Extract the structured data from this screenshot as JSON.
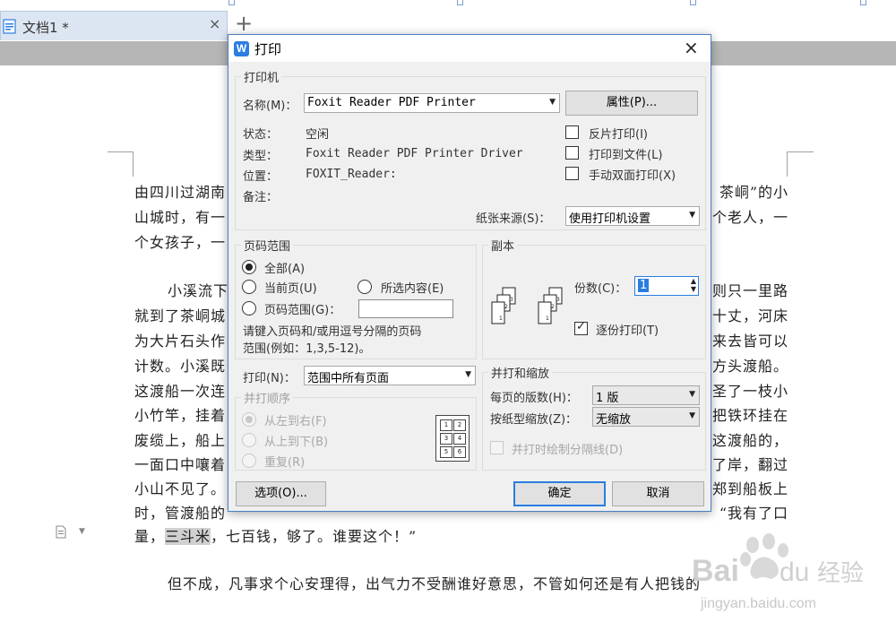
{
  "tab": {
    "title": "文档1 *",
    "close": "×",
    "new_tab": "+"
  },
  "document": {
    "lines": [
      {
        "left": "由四川过湖南",
        "right": "茶峒”的小"
      },
      {
        "left": "山城时，有一",
        "right": "个老人，一"
      },
      {
        "left": "个女孩子，一",
        "right": ""
      },
      {
        "left": "小溪流下",
        "right": "则只一里路"
      },
      {
        "left": "就到了茶峒城",
        "right": "十丈，河床"
      },
      {
        "left": "为大片石头作",
        "right": "来去皆可以"
      },
      {
        "left": "计数。小溪既",
        "right": "方头渡船。"
      },
      {
        "left": "这渡船一次连",
        "right": "圣了一枝小"
      },
      {
        "left": "小竹竿，挂着",
        "right": "把铁环挂在"
      },
      {
        "left": "废缆上，船上",
        "right": "这渡船的，"
      },
      {
        "left": "一面口中嚷着",
        "right": "了岸，翻过"
      },
      {
        "left": "小山不见了。",
        "right": "郑到船板上"
      },
      {
        "left": "时，管渡船的",
        "right": "“我有了口"
      }
    ],
    "line14_highlight": "三斗米",
    "line14_prefix": "量，",
    "line14_suffix": "，七百钱，够了。谁要这个！”",
    "line15": "但不成，凡事求个心安理得，出气力不受酬谁好意思，不管如何还是有人把钱的"
  },
  "dialog": {
    "title": "打印",
    "close": "×",
    "printer": {
      "group_label": "打印机",
      "name_label": "名称(M)：",
      "name_value": "Foxit Reader PDF Printer",
      "properties_button": "属性(P)...",
      "status_label": "状态：",
      "status_value": "空闲",
      "type_label": "类型：",
      "type_value": "Foxit Reader PDF Printer Driver",
      "location_label": "位置：",
      "location_value": "FOXIT_Reader:",
      "comment_label": "备注：",
      "reverse_print": "反片打印(I)",
      "print_to_file": "打印到文件(L)",
      "manual_duplex": "手动双面打印(X)",
      "paper_source_label": "纸张来源(S)：",
      "paper_source_value": "使用打印机设置"
    },
    "page_range": {
      "group_label": "页码范围",
      "all": "全部(A)",
      "current": "当前页(U)",
      "selection": "所选内容(E)",
      "pages": "页码范围(G)：",
      "pages_value": "",
      "hint": "请键入页码和/或用逗号分隔的页码范围(例如：1,3,5-12)。",
      "hint_line1": "请键入页码和/或用逗号分隔的页码",
      "hint_line2": "范围(例如：1,3,5-12)。"
    },
    "copies": {
      "group_label": "副本",
      "count_label": "份数(C)：",
      "count_value": "1",
      "collate": "逐份打印(T)"
    },
    "print_what": {
      "label": "打印(N)：",
      "value": "范围中所有页面"
    },
    "order": {
      "group_label": "并打顺序",
      "left_to_right": "从左到右(F)",
      "top_to_bottom": "从上到下(B)",
      "repeat": "重复(R)",
      "grid_numbers": [
        "1",
        "2",
        "3",
        "4",
        "5",
        "6"
      ]
    },
    "zoom": {
      "group_label": "并打和缩放",
      "pages_per_sheet_label": "每页的版数(H)：",
      "pages_per_sheet_value": "1 版",
      "scale_label": "按纸型缩放(Z)：",
      "scale_value": "无缩放",
      "draw_separator": "并打时绘制分隔线(D)"
    },
    "buttons": {
      "options": "选项(O)...",
      "ok": "确定",
      "cancel": "取消"
    }
  },
  "watermark": {
    "text": "Bai du 经验",
    "url": "jingyan.baidu.com"
  },
  "colors": {
    "accent": "#2a7de1",
    "ribbon": "#b6b6b6",
    "tab": "#dce6f2",
    "dialog_bg": "#f0f0f0"
  }
}
